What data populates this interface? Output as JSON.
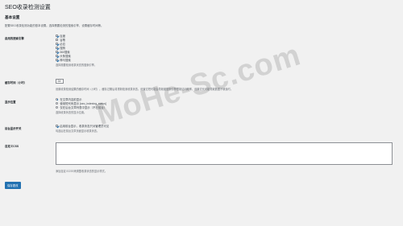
{
  "page": {
    "title": "SEO收录检测设置"
  },
  "basic": {
    "section_title": "基本设置",
    "description": "配置SEO收录检测功能的基本设置。选择需要检测的搜索引擎、设置缓存时间等。"
  },
  "engines": {
    "label": "启用的搜索引擎",
    "items": [
      {
        "label": "百度",
        "checked": true
      },
      {
        "label": "谷歌",
        "checked": false
      },
      {
        "label": "必应",
        "checked": true
      },
      {
        "label": "搜狗",
        "checked": true
      },
      {
        "label": "360搜索",
        "checked": true
      },
      {
        "label": "头条搜索",
        "checked": true
      },
      {
        "label": "神马搜索",
        "checked": true
      }
    ],
    "help": "选择需要检测收录状态的搜索引擎。"
  },
  "cache": {
    "label": "缓存时间（小时）",
    "value": "24",
    "help": "设置收录检测结果的缓存时间（小时）。缓存过期后将重新检测收录状态。设置过短可能会导致被搜索引擎限制访问频率，设置过长可能导致数据不够及时。"
  },
  "position": {
    "label": "显示位置",
    "options": [
      {
        "label": "在文章内容前显示",
        "checked": true
      },
      {
        "label": "使用短代码显示 [seo_indexing_status]",
        "checked": false
      },
      {
        "label": "仅在后台文章列表中显示（不在前台）",
        "checked": false
      }
    ],
    "help": "选择收录状态的显示位置。"
  },
  "frontend": {
    "label": "前台显示开关",
    "checkbox_label": "启用前台显示，收录状态只对管理员可见",
    "checked": true,
    "help": "勾选后在前台文章页面显示收录状态。"
  },
  "custom_css": {
    "label": "自定义CSS",
    "value": "",
    "help": "添加自定义CSS来调整收录状态的显示样式。"
  },
  "actions": {
    "save_label": "保存更改"
  },
  "watermark": {
    "text": "MoHe-Sc.com"
  }
}
